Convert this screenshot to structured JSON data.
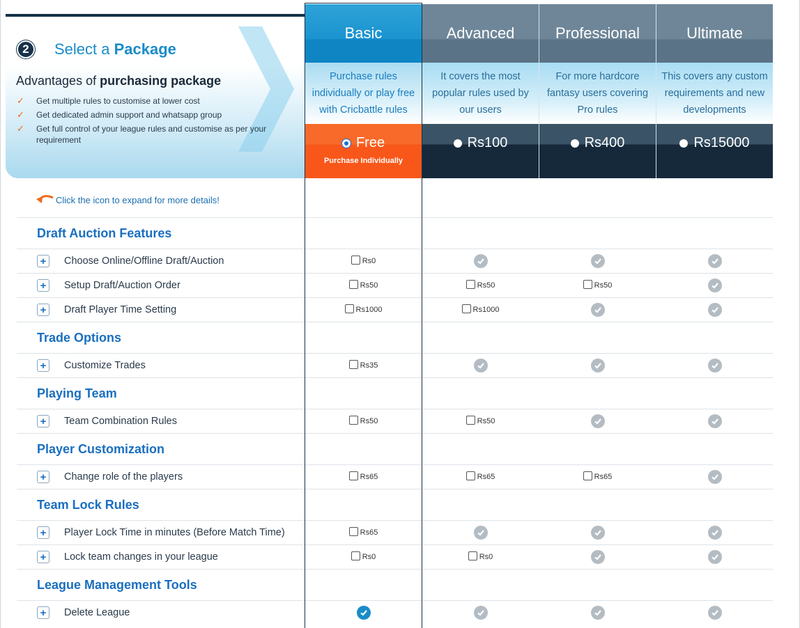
{
  "header": {
    "step_number": "2",
    "step_title_prefix": "Select a",
    "step_title_bold": "Package",
    "advantages_prefix": "Advantages of",
    "advantages_bold": "purchasing package",
    "advantages": [
      "Get multiple rules to customise at lower cost",
      "Get dedicated admin support and whatsapp group",
      "Get full control of your league rules and customise as per your requirement"
    ]
  },
  "plans": [
    {
      "name": "Basic",
      "description": "Purchase rules individually or play free with Cricbattle rules",
      "price": "Free",
      "subtext": "Purchase Individually",
      "selected": true
    },
    {
      "name": "Advanced",
      "description": "It covers the most popular rules used by our users",
      "price": "Rs100",
      "subtext": "",
      "selected": false
    },
    {
      "name": "Professional",
      "description": "For more hardcore fantasy users covering Pro rules",
      "price": "Rs400",
      "subtext": "",
      "selected": false
    },
    {
      "name": "Ultimate",
      "description": "This covers any custom requirements and new developments",
      "price": "Rs15000",
      "subtext": "",
      "selected": false
    }
  ],
  "hint": "Click the icon to expand for more details!",
  "sections": [
    {
      "title": "Draft Auction Features",
      "features": [
        {
          "label": "Choose Online/Offline Draft/Auction",
          "cells": [
            "Rs0",
            "check",
            "check",
            "check"
          ]
        },
        {
          "label": "Setup Draft/Auction Order",
          "cells": [
            "Rs50",
            "Rs50",
            "Rs50",
            "check"
          ]
        },
        {
          "label": "Draft Player Time Setting",
          "cells": [
            "Rs1000",
            "Rs1000",
            "check",
            "check"
          ]
        }
      ]
    },
    {
      "title": "Trade Options",
      "features": [
        {
          "label": "Customize Trades",
          "cells": [
            "Rs35",
            "check",
            "check",
            "check"
          ]
        }
      ]
    },
    {
      "title": "Playing Team",
      "features": [
        {
          "label": "Team Combination Rules",
          "cells": [
            "Rs50",
            "Rs50",
            "check",
            "check"
          ]
        }
      ]
    },
    {
      "title": "Player Customization",
      "features": [
        {
          "label": "Change role of the players",
          "cells": [
            "Rs65",
            "Rs65",
            "Rs65",
            "check"
          ]
        }
      ]
    },
    {
      "title": "Team Lock Rules",
      "features": [
        {
          "label": "Player Lock Time in minutes (Before Match Time)",
          "cells": [
            "Rs65",
            "check",
            "check",
            "check"
          ]
        },
        {
          "label": "Lock team changes in your league",
          "cells": [
            "Rs0",
            "Rs0",
            "check",
            "check"
          ]
        }
      ]
    },
    {
      "title": "League Management Tools",
      "features": [
        {
          "label": "Delete League",
          "cells": [
            "check-active",
            "check",
            "check",
            "check"
          ]
        }
      ]
    }
  ],
  "colors": {
    "accent": "#1a8cc8",
    "orange": "#f9571a",
    "dark_navy": "#15293b"
  }
}
